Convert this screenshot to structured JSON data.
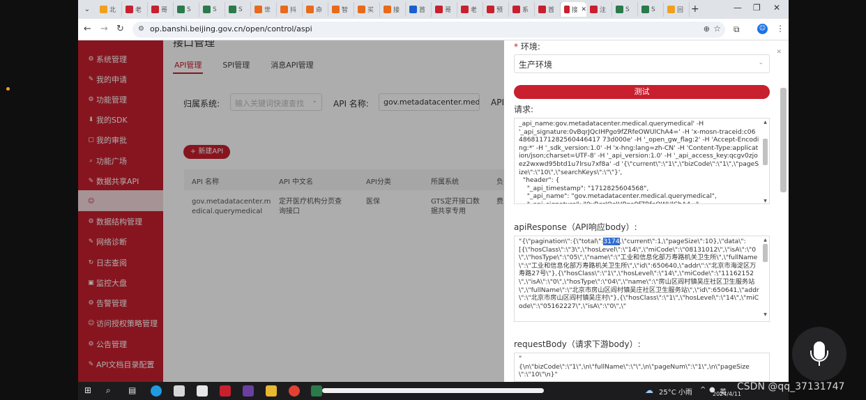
{
  "browser": {
    "tabs": [
      {
        "label": "北",
        "color": "#f0a020"
      },
      {
        "label": "老",
        "color": "#c8202e"
      },
      {
        "label": "哥",
        "color": "#c8202e"
      },
      {
        "label": "S",
        "color": "#2b7a4b"
      },
      {
        "label": "S",
        "color": "#2b7a4b"
      },
      {
        "label": "S",
        "color": "#2b7a4b"
      },
      {
        "label": "世",
        "color": "#e86a1a"
      },
      {
        "label": "抖",
        "color": "#e86a1a"
      },
      {
        "label": "命",
        "color": "#e86a1a"
      },
      {
        "label": "智",
        "color": "#e86a1a"
      },
      {
        "label": "买",
        "color": "#e86a1a"
      },
      {
        "label": "接",
        "color": "#e86a1a"
      },
      {
        "label": "首",
        "color": "#1a5fd0"
      },
      {
        "label": "哥",
        "color": "#c8202e"
      },
      {
        "label": "老",
        "color": "#c8202e"
      },
      {
        "label": "预",
        "color": "#c8202e"
      },
      {
        "label": "系",
        "color": "#c8202e"
      },
      {
        "label": "首",
        "color": "#c8202e"
      },
      {
        "label": "接",
        "color": "#c8202e",
        "active": true
      },
      {
        "label": "注",
        "color": "#c8202e"
      },
      {
        "label": "S",
        "color": "#2b7a4b"
      },
      {
        "label": "S",
        "color": "#2b7a4b"
      },
      {
        "label": "回",
        "color": "#f0a020"
      }
    ],
    "url": "op.banshi.beijing.gov.cn/open/control/aspi"
  },
  "sidebar": {
    "items": [
      {
        "label": "系统管理",
        "icon": "⚙"
      },
      {
        "label": "我的申请",
        "icon": "✎"
      },
      {
        "label": "功能管理",
        "icon": "⚙"
      },
      {
        "label": "我的SDK",
        "icon": "⬇"
      },
      {
        "label": "我的审批",
        "icon": "▢"
      },
      {
        "label": "功能广场",
        "icon": "⌕"
      },
      {
        "label": "数据共享API",
        "icon": "✎"
      },
      {
        "label": "",
        "icon": "☺"
      },
      {
        "label": "数据结构管理",
        "icon": "⚙"
      },
      {
        "label": "网络诊断",
        "icon": "✎"
      },
      {
        "label": "日志查阅",
        "icon": "↻"
      },
      {
        "label": "监控大盘",
        "icon": "▣"
      },
      {
        "label": "告警管理",
        "icon": "⚙"
      },
      {
        "label": "访问授权策略管理",
        "icon": "☺"
      },
      {
        "label": "公告管理",
        "icon": "⚙"
      },
      {
        "label": "API文档目录配置",
        "icon": "✎"
      }
    ]
  },
  "main": {
    "title": "接口管理",
    "tabs": [
      "API管理",
      "SPI管理",
      "消息API管理"
    ],
    "filter": {
      "system_label": "归属系统:",
      "system_placeholder": "输入关键词快速查找",
      "name_label": "API 名称:",
      "name_value": "gov.metadatacenter.medic",
      "extra_label": "API"
    },
    "new_button": "+ 新建API",
    "table": {
      "headers": [
        "API 名称",
        "API 中文名",
        "API分类",
        "所属系统",
        "负"
      ],
      "row": [
        "gov.metadatacenter.m\nedical.querymedical",
        "定开医疗机构分页查\n询接口",
        "医保",
        "GTS定开接口数\n据共享专用",
        "费"
      ]
    }
  },
  "drawer": {
    "env_required": "*",
    "env_label": "环境:",
    "env_value": "生产环境",
    "test_button": "测试",
    "request_label": "请求:",
    "request_body": "_api_name:gov.metadatacenter.medical.querymedical' -H\n'_api_signature:0vBqrJQcIHPgo9fZRfeOWUlChA4=' -H 'x-mosn-traceid:c0648681171282560446417 73d000e' -H '_open_gw_flag:2' -H 'Accept-Encoding:*' -H '_sdk_version:1.0' -H 'x-hng:lang=zh-CN' -H 'Content-Type:application/json;charset=UTF-8' -H '_api_version:1.0' -H '_api_access_key:qcgv0zjoez2wxwd95btd1u7lrsu7xf8a' -d '{\\\"current\\\":\\\"1\\\",\\\"bizCode\\\":\\\"1\\\",\\\"pageSize\\\":\\\"10\\\",\\\"searchKeys\\\":\\\"\\\"}',\n  \"header\": {\n    \"_api_timestamp\": \"1712825604568\",\n    \"_api_name\": \"gov.metadatacenter.medical.querymedical\",\n    \"_api_signature\": \"0vBqrJQcIHPgo9fZRfeOWUlChA4=\",",
    "response_label": "apiResponse（API响应body）:",
    "response_pre": "\"{\\\"pagination\\\":{\\\"total\\\":",
    "response_total": "3174",
    "response_post": ",\\\"current\\\":1,\\\"pageSize\\\":10},\\\"data\\\":[{\\\"hosClass\\\":\\\"3\\\",\\\"hosLevel\\\":\\\"14\\\",\\\"miCode\\\":\\\"08131012\\\",\\\"isA\\\":\\\"0\\\",\\\"hosType\\\":\\\"05\\\",\\\"name\\\":\\\"工业和信息化部万寿路机关卫生所\\\",\\\"fullName\\\":\\\"工业和信息化部万寿路机关卫生所\\\",\\\"id\\\":650640,\\\"addr\\\":\\\"北京市海淀区万寿路27号\\\"},{\\\"hosClass\\\":\\\"1\\\",\\\"hosLevel\\\":\\\"14\\\",\\\"miCode\\\":\\\"11162152\\\",\\\"isA\\\":\\\"0\\\",\\\"hosType\\\":\\\"04\\\",\\\"name\\\":\\\"房山区阎村镇吴庄社区卫生服务站\\\",\\\"fullName\\\":\\\"北京市房山区阎村镇吴庄社区卫生服务站\\\",\\\"id\\\":650641,\\\"addr\\\":\\\"北京市房山区阎村镇吴庄村\\\"},{\\\"hosClass\\\":\\\"1\\\",\\\"hosLevel\\\":\\\"14\\\",\\\"miCode\\\":\\\"05162227\\\",\\\"isA\\\":\\\"0\\\",\\\"",
    "requestbody_label": "requestBody（请求下游body）:",
    "requestbody_value": "\"\n{\\n\\\"bizCode\\\":\\\"1\\\",\\n\\\"fullName\\\":\\\"\\\",\\n\\\"pageNum\\\":\\\"1\\\",\\n\\\"pageSize\\\":\\\"10\\\"\\n}\""
  },
  "taskbar": {
    "weather": "25°C 小雨",
    "lang": "英",
    "date": "2024/4/11"
  },
  "watermark": "CSDN @qq_37131747"
}
